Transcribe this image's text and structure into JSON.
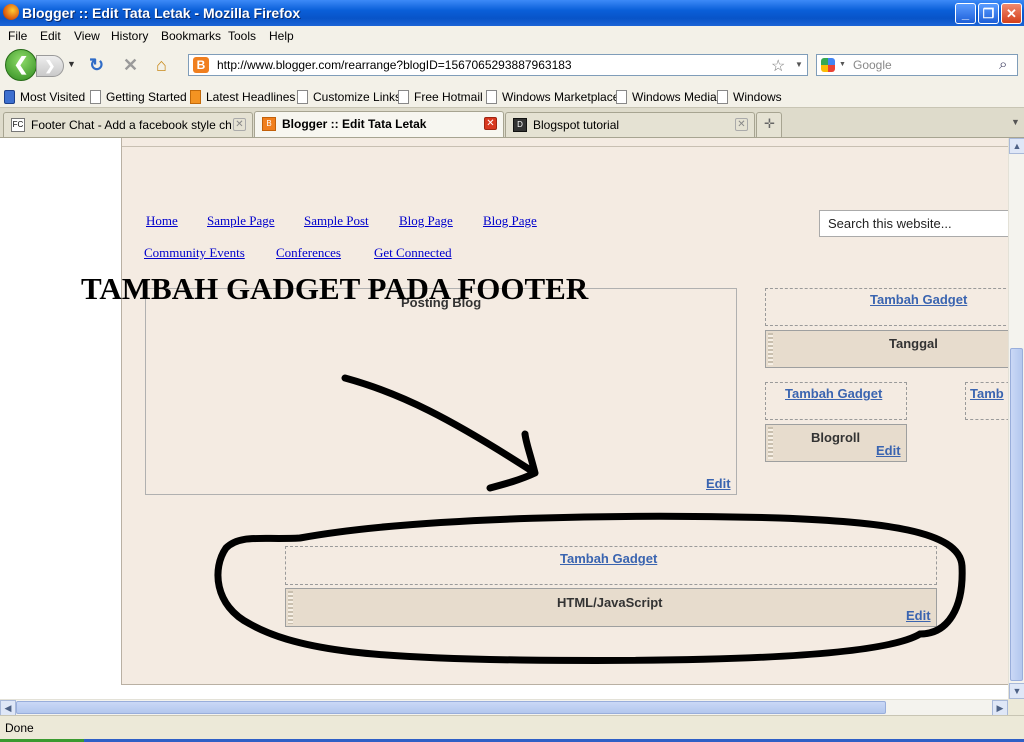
{
  "window": {
    "title": "Blogger :: Edit Tata Letak - Mozilla Firefox",
    "controls": {
      "minimize": "_",
      "restore": "❐",
      "close": "✕"
    }
  },
  "menu": [
    "File",
    "Edit",
    "View",
    "History",
    "Bookmarks",
    "Tools",
    "Help"
  ],
  "nav": {
    "url": "http://www.blogger.com/rearrange?blogID=1567065293887963183",
    "search_placeholder": "Google"
  },
  "bookmarks": [
    "Most Visited",
    "Getting Started",
    "Latest Headlines",
    "Customize Links",
    "Free Hotmail",
    "Windows Marketplace",
    "Windows Media",
    "Windows"
  ],
  "tabs": [
    {
      "label": "Footer Chat - Add a facebook style cha...",
      "fav": "FC"
    },
    {
      "label": "Blogger :: Edit Tata Letak",
      "fav": "B"
    },
    {
      "label": "Blogspot tutorial",
      "fav": "D"
    }
  ],
  "page": {
    "nav_row1": [
      "Home",
      "Sample Page",
      "Sample Post",
      "Blog Page",
      "Blog Page"
    ],
    "nav_row2": [
      "Community Events",
      "Conferences",
      "Get Connected"
    ],
    "search_placeholder": "Search this website...",
    "overlay_title": "TAMBAH GADGET PADA FOOTER",
    "main_widget": "Posting Blog",
    "add_gadget": "Tambah Gadget",
    "add_gadget_cut": "Tamb",
    "sidebar_widget_1": "Tanggal",
    "sidebar_widget_2": "Blogroll",
    "footer_widget": "HTML/JavaScript",
    "edit": "Edit"
  },
  "status": "Done"
}
